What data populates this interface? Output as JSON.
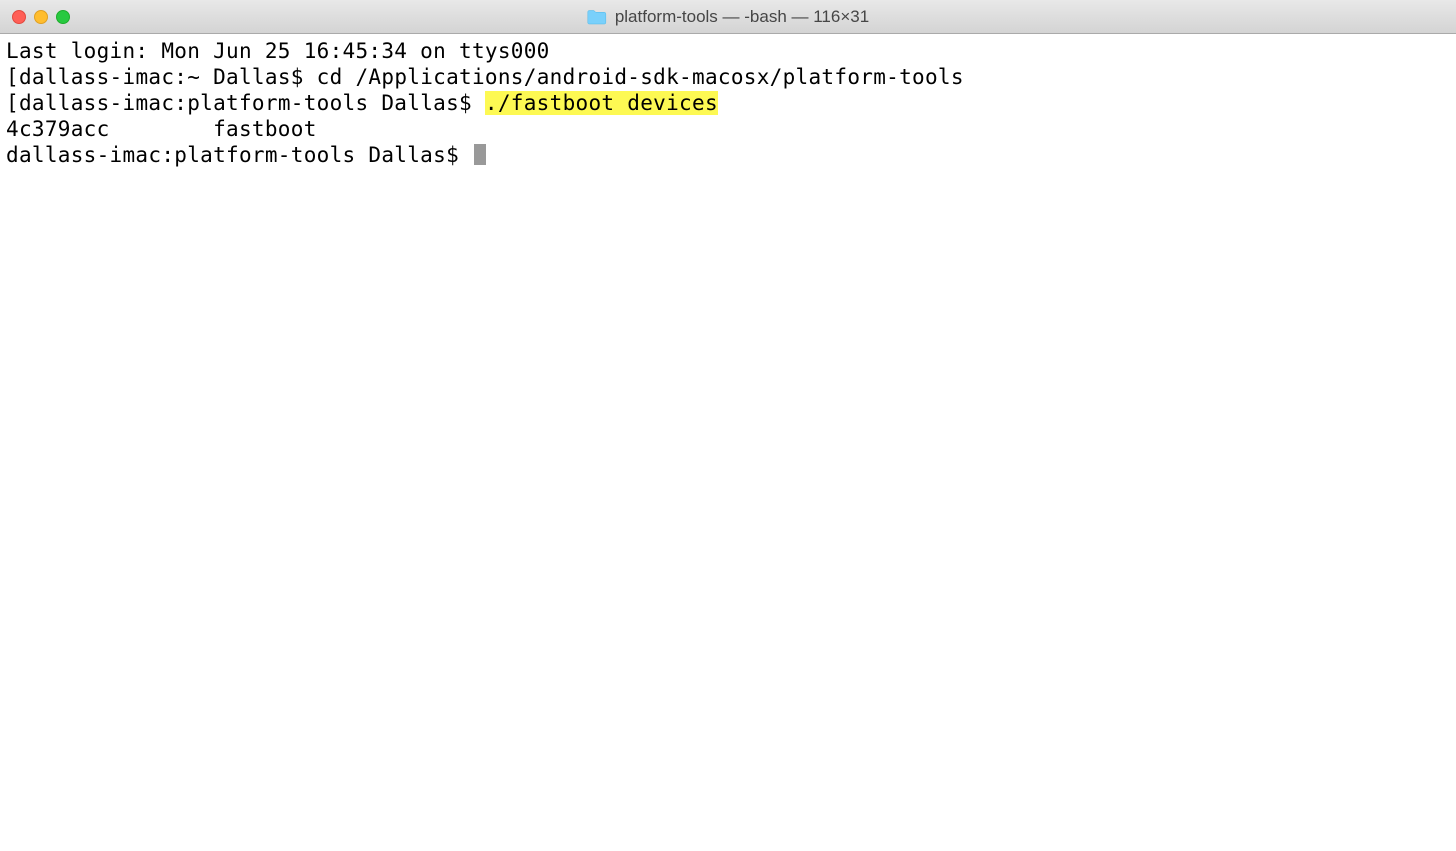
{
  "titlebar": {
    "title": "platform-tools — -bash — 116×31"
  },
  "terminal": {
    "lines": {
      "l0": "Last login: Mon Jun 25 16:45:34 on ttys000",
      "l1_bracket": "[",
      "l1_prompt": "dallass-imac:~ Dallas$ ",
      "l1_cmd": "cd /Applications/android-sdk-macosx/platform-tools",
      "l2_bracket": "[",
      "l2_prompt": "dallass-imac:platform-tools Dallas$ ",
      "l2_cmd": "./fastboot devices",
      "l3_out": "4c379acc        fastboot",
      "l4_prompt": "dallass-imac:platform-tools Dallas$ "
    }
  }
}
